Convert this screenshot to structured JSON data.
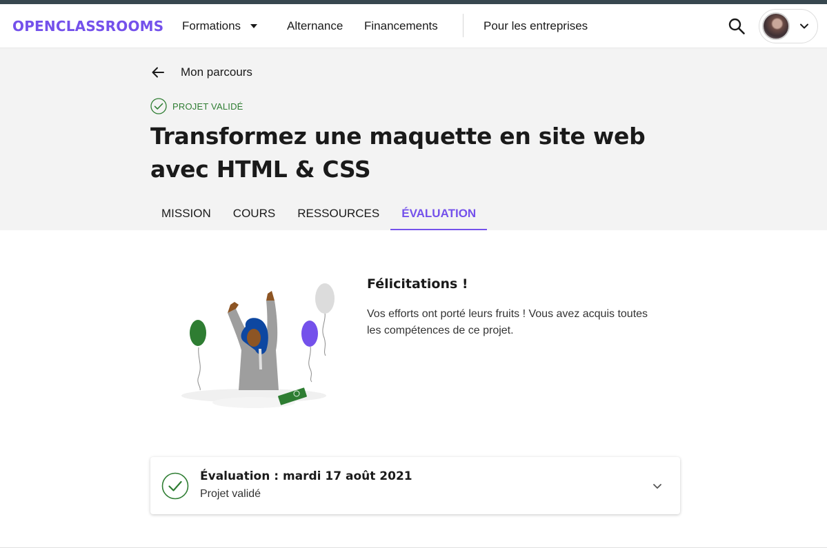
{
  "brand": {
    "logo_text": "OPENCLASSROOMS",
    "accent_color": "#7451eb",
    "success_color": "#2e7d32"
  },
  "nav": {
    "formations": "Formations",
    "alternance": "Alternance",
    "financements": "Financements",
    "entreprises": "Pour les entreprises",
    "icons": [
      "search-icon",
      "chevron-down-icon",
      "avatar"
    ]
  },
  "hero": {
    "back_label": "Mon parcours",
    "status_label": "PROJET VALIDÉ",
    "title": "Transformez une maquette en site web avec HTML & CSS"
  },
  "tabs": [
    {
      "label": "MISSION",
      "active": false
    },
    {
      "label": "COURS",
      "active": false
    },
    {
      "label": "RESSOURCES",
      "active": false
    },
    {
      "label": "ÉVALUATION",
      "active": true
    }
  ],
  "congrats": {
    "title": "Félicitations !",
    "text": "Vos efforts ont porté leurs fruits ! Vous avez acquis toutes les compétences de ce projet."
  },
  "evaluation": {
    "title": "Évaluation : mardi 17 août 2021",
    "subtitle": "Projet validé"
  }
}
